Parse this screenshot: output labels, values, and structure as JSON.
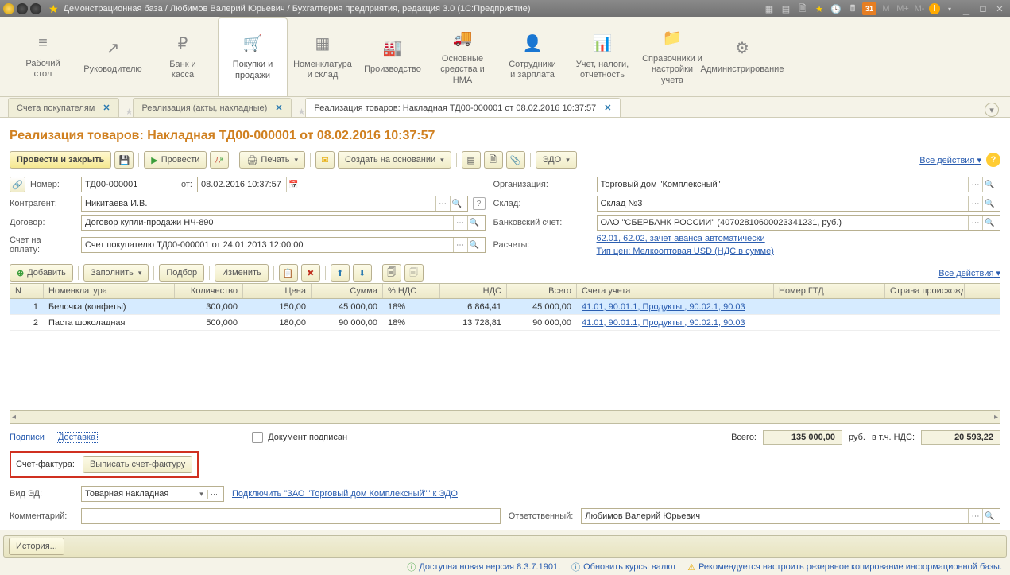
{
  "title": "Демонстрационная база / Любимов Валерий Юрьевич / Бухгалтерия предприятия, редакция 3.0  (1С:Предприятие)",
  "title_icons": {
    "cal": "31",
    "m": "M",
    "mp": "M+",
    "mm": "M-"
  },
  "sections": [
    {
      "label": "Рабочий\nстол",
      "icon": "≡"
    },
    {
      "label": "Руководителю",
      "icon": "↗"
    },
    {
      "label": "Банк и\nкасса",
      "icon": "₽"
    },
    {
      "label": "Покупки и\nпродажи",
      "icon": "🛒",
      "active": true
    },
    {
      "label": "Номенклатура\nи склад",
      "icon": "▦"
    },
    {
      "label": "Производство",
      "icon": "🏭"
    },
    {
      "label": "Основные\nсредства и НМА",
      "icon": "🚚"
    },
    {
      "label": "Сотрудники\nи зарплата",
      "icon": "👤"
    },
    {
      "label": "Учет, налоги,\nотчетность",
      "icon": "📊"
    },
    {
      "label": "Справочники и\nнастройки учета",
      "icon": "📁"
    },
    {
      "label": "Администрирование",
      "icon": "⚙"
    }
  ],
  "tabs": [
    {
      "label": "Счета покупателям"
    },
    {
      "label": "Реализация (акты, накладные)"
    },
    {
      "label": "Реализация товаров: Накладная ТД00-000001 от 08.02.2016 10:37:57",
      "active": true
    }
  ],
  "doc_title": "Реализация товаров: Накладная ТД00-000001 от 08.02.2016 10:37:57",
  "cmdbar": {
    "post_close": "Провести и закрыть",
    "post": "Провести",
    "print": "Печать",
    "create_based": "Создать на основании",
    "edo": "ЭДО",
    "all_actions": "Все действия"
  },
  "form": {
    "num_label": "Номер:",
    "num": "ТД00-000001",
    "date_label": "от:",
    "date": "08.02.2016 10:37:57",
    "org_label": "Организация:",
    "org": "Торговый дом \"Комплексный\"",
    "ctr_label": "Контрагент:",
    "ctr": "Никитаева И.В.",
    "store_label": "Склад:",
    "store": "Склад №3",
    "agr_label": "Договор:",
    "agr": "Договор купли-продажи НЧ-890",
    "bank_label": "Банковский счет:",
    "bank": "ОАО \"СБЕРБАНК РОССИИ\" (40702810600023341231, руб.)",
    "invoice_label": "Счет на оплату:",
    "invoice": "Счет покупателю ТД00-000001 от 24.01.2013 12:00:00",
    "calc_label": "Расчеты:",
    "calc_link": "62.01, 62.02, зачет аванса автоматически",
    "price_link": "Тип цен: Мелкооптовая USD (НДС в сумме)"
  },
  "tbl_bar": {
    "add": "Добавить",
    "fill": "Заполнить",
    "pick": "Подбор",
    "change": "Изменить",
    "all": "Все действия"
  },
  "columns": {
    "n": "N",
    "nom": "Номенклатура",
    "qty": "Количество",
    "price": "Цена",
    "sum": "Сумма",
    "vatp": "% НДС",
    "vat": "НДС",
    "total": "Всего",
    "acc": "Счета учета",
    "gtd": "Номер ГТД",
    "cty": "Страна происхожде..."
  },
  "rows": [
    {
      "n": "1",
      "nom": "Белочка (конфеты)",
      "qty": "300,000",
      "price": "150,00",
      "sum": "45 000,00",
      "vatp": "18%",
      "vat": "6 864,41",
      "total": "45 000,00",
      "acc": "41.01, 90.01.1, Продукты , 90.02.1, 90.03"
    },
    {
      "n": "2",
      "nom": "Паста шоколадная",
      "qty": "500,000",
      "price": "180,00",
      "sum": "90 000,00",
      "vatp": "18%",
      "vat": "13 728,81",
      "total": "90 000,00",
      "acc": "41.01, 90.01.1, Продукты , 90.02.1, 90.03"
    }
  ],
  "footer": {
    "signatures": "Подписи",
    "delivery": "Доставка",
    "signed": "Документ подписан",
    "total_label": "Всего:",
    "total": "135 000,00",
    "rub": "руб.",
    "vat_label": "в т.ч. НДС:",
    "vat": "20 593,22"
  },
  "sf": {
    "label": "Счет-фактура:",
    "btn": "Выписать счет-фактуру"
  },
  "ed": {
    "label": "Вид ЭД:",
    "value": "Товарная накладная",
    "connect": "Подключить \"ЗАО \"Торговый дом Комплексный\"\" к ЭДО"
  },
  "comment": {
    "label": "Комментарий:",
    "resp_label": "Ответственный:",
    "resp": "Любимов Валерий Юрьевич"
  },
  "history_btn": "История...",
  "status": {
    "ver": "Доступна новая версия 8.3.7.1901.",
    "rates": "Обновить курсы валют",
    "backup": "Рекомендуется настроить резервное копирование информационной базы."
  }
}
